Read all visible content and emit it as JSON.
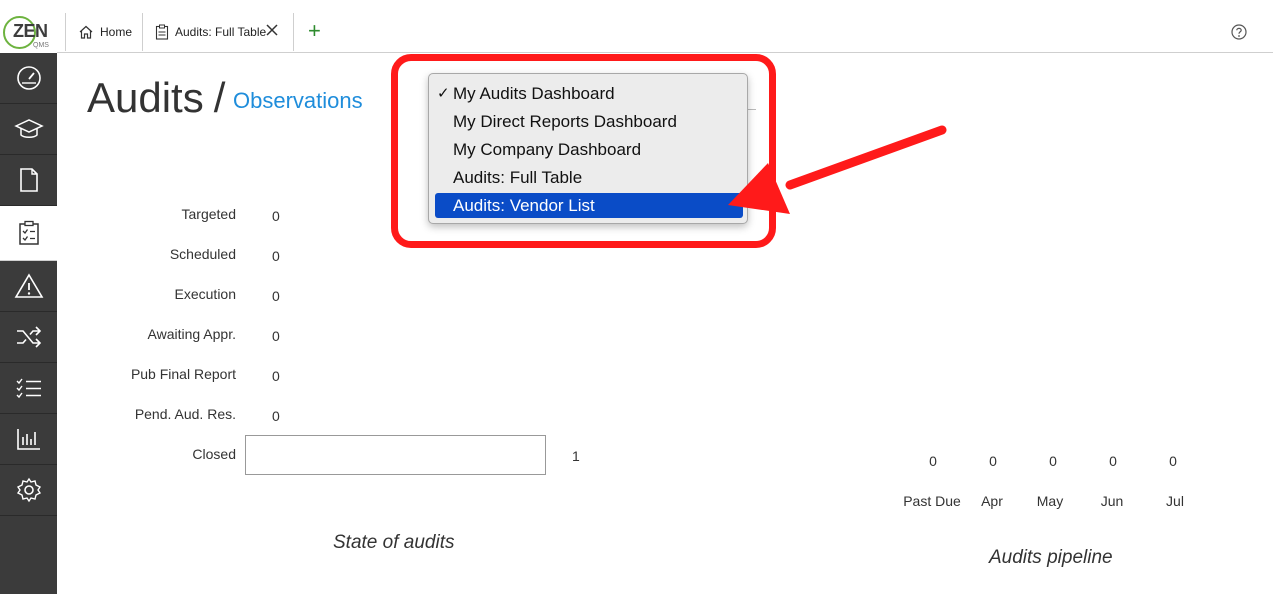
{
  "app": {
    "logo_text": "ZEN",
    "logo_sub": "QMS"
  },
  "tabs": [
    {
      "label": "Home",
      "icon": "home-icon"
    },
    {
      "label": "Audits: Full Table",
      "icon": "clipboard-icon"
    }
  ],
  "page": {
    "title": "Audits",
    "separator": "/",
    "breadcrumb": "Observations"
  },
  "dropdown": {
    "items": [
      {
        "label": "My Audits Dashboard",
        "checked": true,
        "highlighted": false
      },
      {
        "label": "My Direct Reports Dashboard",
        "checked": false,
        "highlighted": false
      },
      {
        "label": "My Company Dashboard",
        "checked": false,
        "highlighted": false
      },
      {
        "label": "Audits: Full Table",
        "checked": false,
        "highlighted": false
      },
      {
        "label": "Audits: Vendor List",
        "checked": false,
        "highlighted": true
      }
    ],
    "check_glyph": "✓"
  },
  "state_of_audits": {
    "caption": "State of audits",
    "rows": [
      {
        "label": "Targeted",
        "value": "0"
      },
      {
        "label": "Scheduled",
        "value": "0"
      },
      {
        "label": "Execution",
        "value": "0"
      },
      {
        "label": "Awaiting Appr.",
        "value": "0"
      },
      {
        "label": "Pub Final Report",
        "value": "0"
      },
      {
        "label": "Pend. Aud. Res.",
        "value": "0"
      },
      {
        "label": "Closed",
        "value": "1"
      }
    ]
  },
  "pipeline": {
    "caption": "Audits pipeline",
    "columns": [
      {
        "label": "Past Due",
        "value": "0"
      },
      {
        "label": "Apr",
        "value": "0"
      },
      {
        "label": "May",
        "value": "0"
      },
      {
        "label": "Jun",
        "value": "0"
      },
      {
        "label": "Jul",
        "value": "0"
      }
    ]
  },
  "colors": {
    "accent": "#1f8ddb",
    "highlight": "#ff1a1a",
    "selection": "#0a4cc7",
    "sidebar": "#3b3b3b"
  }
}
